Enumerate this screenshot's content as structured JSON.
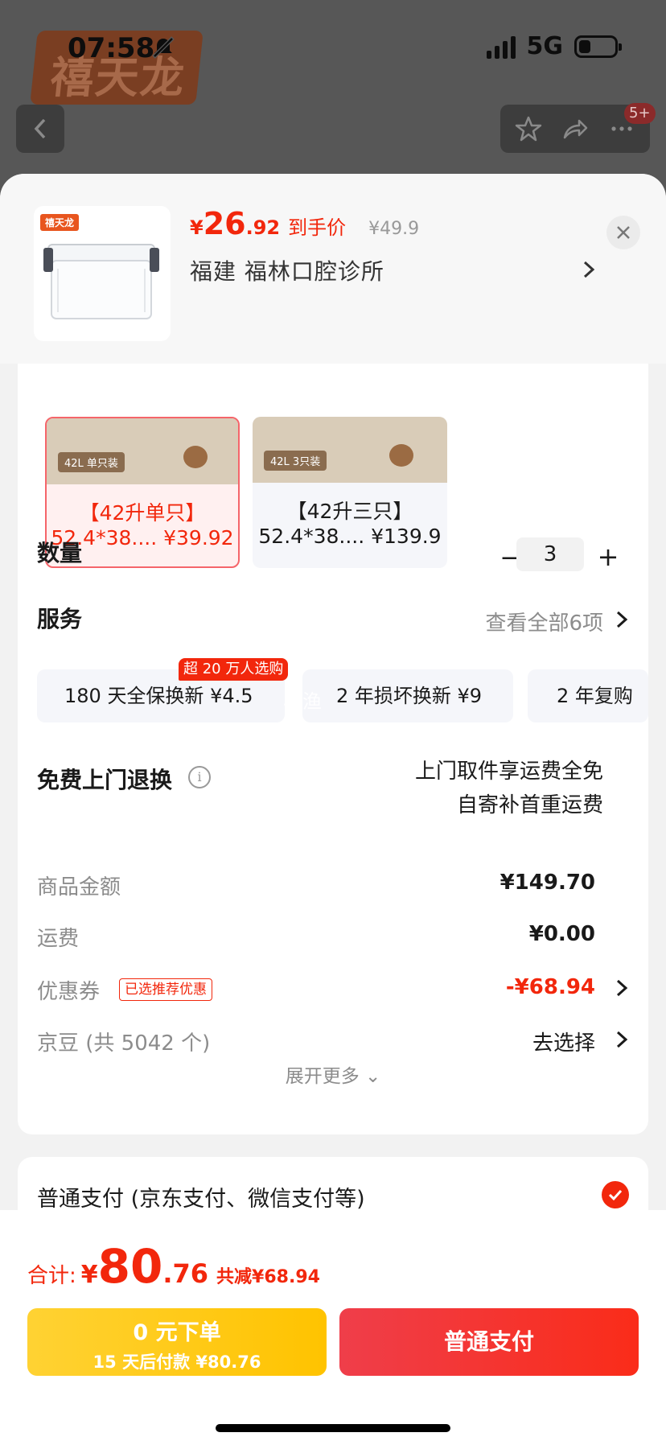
{
  "status_bar": {
    "time": "07:58",
    "network": "5G"
  },
  "background": {
    "logo_text": "禧天龙",
    "more_badge": "5+"
  },
  "product": {
    "logo_text": "禧天龙",
    "price_symbol": "¥",
    "price_int": "26",
    "price_dec": ".92",
    "price_tag": "到手价",
    "price_original": "¥49.9",
    "address": "福建  福林口腔诊所"
  },
  "variants": [
    {
      "pill": "42L 单只装",
      "name": "【42升单只】",
      "sub": "52.4*38.... ¥39.92",
      "selected": true
    },
    {
      "pill": "42L 3只装",
      "name": "【42升三只】",
      "sub": "52.4*38.... ¥139.9",
      "selected": false
    }
  ],
  "quantity": {
    "label": "数量",
    "minus": "−",
    "value": "3",
    "plus": "+"
  },
  "service": {
    "label": "服务",
    "view_all": "查看全部6项",
    "chips": [
      {
        "label": "180 天全保换新   ¥4.5"
      },
      {
        "label": "2 年损坏换新   ¥9"
      },
      {
        "label": "2 年复购"
      }
    ],
    "badge": "超 20 万人选购",
    "watermark": "小渔"
  },
  "return": {
    "label": "免费上门退换",
    "line1": "上门取件享运费全免",
    "line2": "自寄补首重运费"
  },
  "fees": {
    "goods_label": "商品金额",
    "goods_value": "¥149.70",
    "shipping_label": "运费",
    "shipping_value": "¥0.00",
    "coupon_label": "优惠券",
    "coupon_tag": "已选推荐优惠",
    "coupon_value": "-¥68.94",
    "jd_label": "京豆 (共 5042 个)",
    "jd_value": "去选择",
    "expand": "展开更多 ⌄"
  },
  "payment": {
    "label": "普通支付 (京东支付、微信支付等)"
  },
  "total": {
    "label": "合计:",
    "symbol": "¥",
    "int": "80",
    "dec": ".76",
    "discount": "共减¥68.94"
  },
  "buttons": {
    "later_line1": "0 元下单",
    "later_line2": "15 天后付款 ¥80.76",
    "pay": "普通支付"
  },
  "colors": {
    "accent": "#f2270c",
    "yellow": "#ffc300",
    "sheet_bg": "#f2f2f2"
  }
}
